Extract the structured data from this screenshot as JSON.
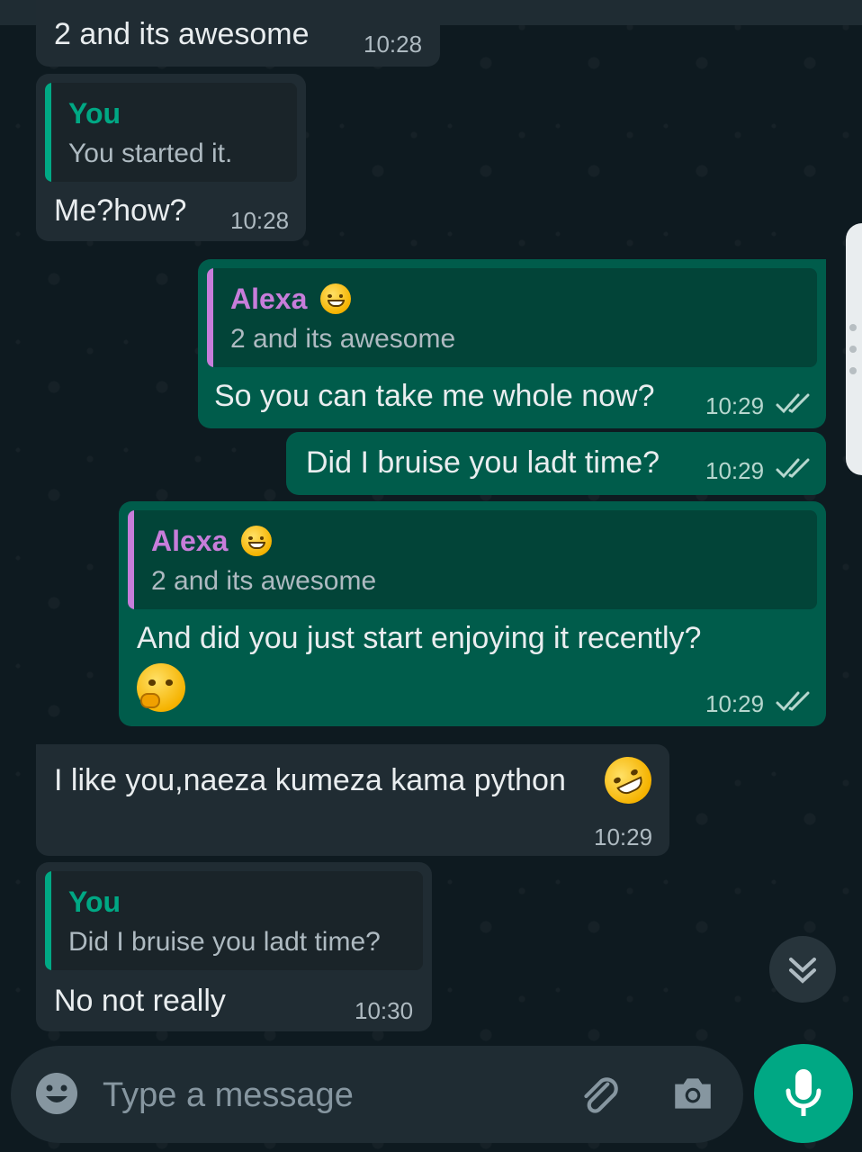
{
  "messages": [
    {
      "direction": "in",
      "text": "2 and its awesome",
      "time": "10:28"
    },
    {
      "direction": "in",
      "quote": {
        "author": "You",
        "text": "You started it."
      },
      "text": "Me?how?",
      "time": "10:28"
    },
    {
      "direction": "out",
      "quote": {
        "author": "Alexa",
        "author_emoji": "grinning-face",
        "text": "2 and its awesome"
      },
      "text": "So you can take me whole now?",
      "time": "10:29",
      "status": "read"
    },
    {
      "direction": "out",
      "text": "Did I bruise you ladt time?",
      "time": "10:29",
      "status": "read"
    },
    {
      "direction": "out",
      "quote": {
        "author": "Alexa",
        "author_emoji": "grinning-face",
        "text": "2 and its awesome"
      },
      "text": "And did you just start enjoying it recently?",
      "emoji": "thinking-face",
      "time": "10:29",
      "status": "read"
    },
    {
      "direction": "in",
      "text": "I like you,naeza kumeza kama python",
      "emoji": "rolling-on-floor-laughing",
      "time": "10:29"
    },
    {
      "direction": "in",
      "quote": {
        "author": "You",
        "text": "Did I bruise you ladt time?"
      },
      "text": "No not really",
      "time": "10:30"
    }
  ],
  "composer": {
    "placeholder": "Type a message",
    "icons": [
      "emoji-icon",
      "attach-icon",
      "camera-icon"
    ],
    "mic_icon": "mic-icon"
  },
  "scroll_down_icon": "double-chevron-down-icon",
  "colors": {
    "background": "#0b141a",
    "incoming_bubble": "#202c33",
    "outgoing_bubble": "#005c4b",
    "quote_you": "#00a884",
    "quote_alexa": "#c77dda",
    "read_ticks": "#b7d7cf",
    "mic_button": "#00a884"
  }
}
